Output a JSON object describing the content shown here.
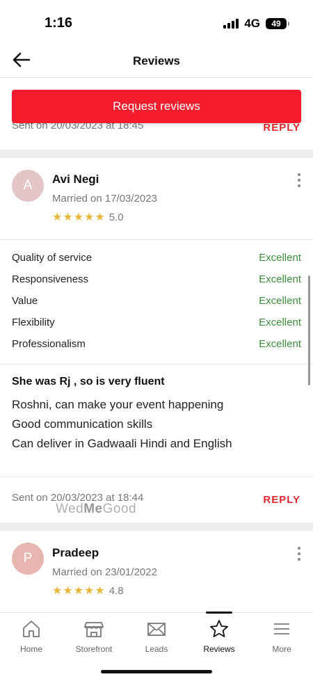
{
  "status_bar": {
    "time": "1:16",
    "network": "4G",
    "battery": "49"
  },
  "header": {
    "title": "Reviews"
  },
  "request_button": {
    "label": "Request reviews"
  },
  "previous_review": {
    "sent": "Sent on 20/03/2023 at 18:45",
    "reply": "REPLY"
  },
  "reviews": [
    {
      "initial": "A",
      "avatar_color": "#e3c5c8",
      "name": "Avi Negi",
      "married_on": "Married on 17/03/2023",
      "rating": "5.0",
      "stars": 5,
      "criteria": [
        {
          "label": "Quality of service",
          "value": "Excellent"
        },
        {
          "label": "Responsiveness",
          "value": "Excellent"
        },
        {
          "label": "Value",
          "value": "Excellent"
        },
        {
          "label": "Flexibility",
          "value": "Excellent"
        },
        {
          "label": "Professionalism",
          "value": "Excellent"
        }
      ],
      "title": "She was Rj , so is very fluent",
      "body": [
        "Roshni, can make your event happening",
        "Good communication skills",
        "Can deliver in Gadwaali Hindi and English"
      ],
      "sent": "Sent on 20/03/2023 at 18:44",
      "reply": "REPLY"
    },
    {
      "initial": "P",
      "avatar_color": "#e8b6b0",
      "name": "Pradeep",
      "married_on": "Married on 23/01/2022",
      "rating": "4.8",
      "stars": 5
    }
  ],
  "watermark": {
    "part1": "Wed",
    "part2": "Me",
    "part3": "Good"
  },
  "nav": [
    {
      "label": "Home",
      "icon": "home-icon"
    },
    {
      "label": "Storefront",
      "icon": "storefront-icon"
    },
    {
      "label": "Leads",
      "icon": "mail-icon"
    },
    {
      "label": "Reviews",
      "icon": "star-outline-icon",
      "active": true
    },
    {
      "label": "More",
      "icon": "menu-icon"
    }
  ],
  "colors": {
    "accent": "#f51c2e",
    "reply": "#e0272e",
    "excellent": "#3c8d3c",
    "star": "#e6b73a"
  }
}
